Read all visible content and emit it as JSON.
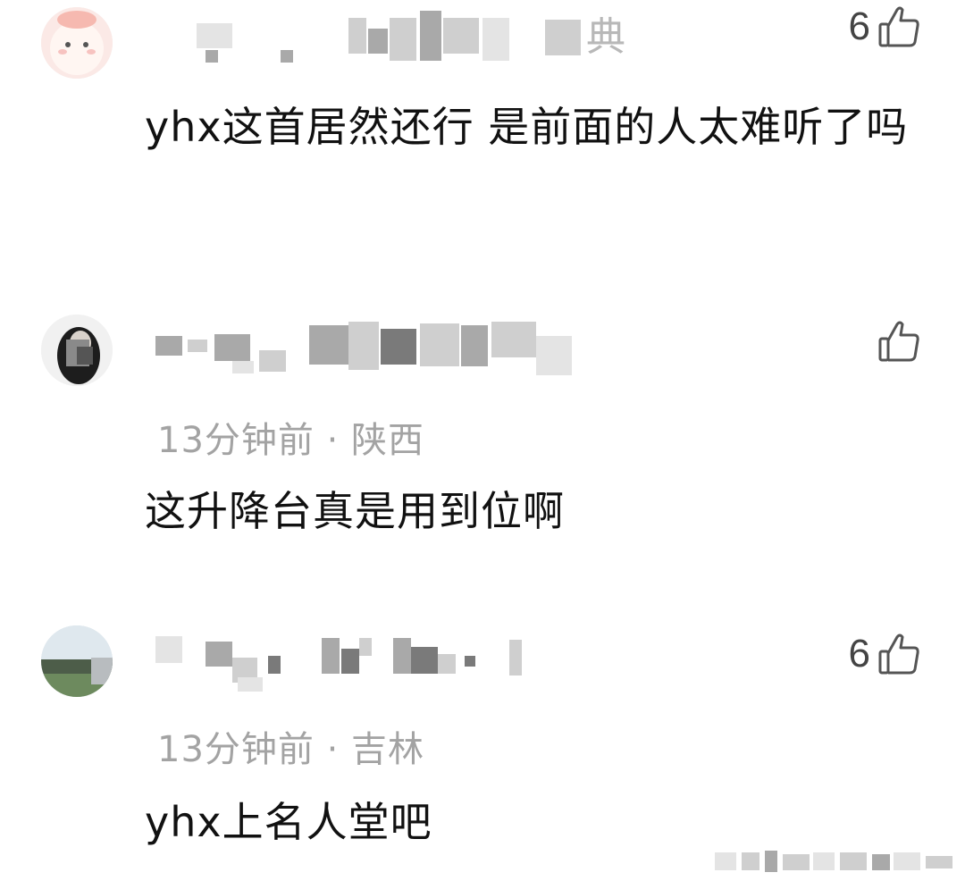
{
  "comments": [
    {
      "username_visible": "典",
      "likes": "6",
      "text": "yhx这首居然还行 是前面的人太难听了吗",
      "meta": ""
    },
    {
      "username_visible": "",
      "likes": "",
      "meta": "13分钟前 · 陕西",
      "text": "这升降台真是用到位啊"
    },
    {
      "username_visible": "",
      "likes": "6",
      "meta": "13分钟前 · 吉林",
      "text": "yhx上名人堂吧"
    }
  ],
  "icons": {
    "like": "thumbs-up-icon"
  },
  "colors": {
    "text": "#111111",
    "meta": "#a3a3a3",
    "likes": "#444444"
  }
}
